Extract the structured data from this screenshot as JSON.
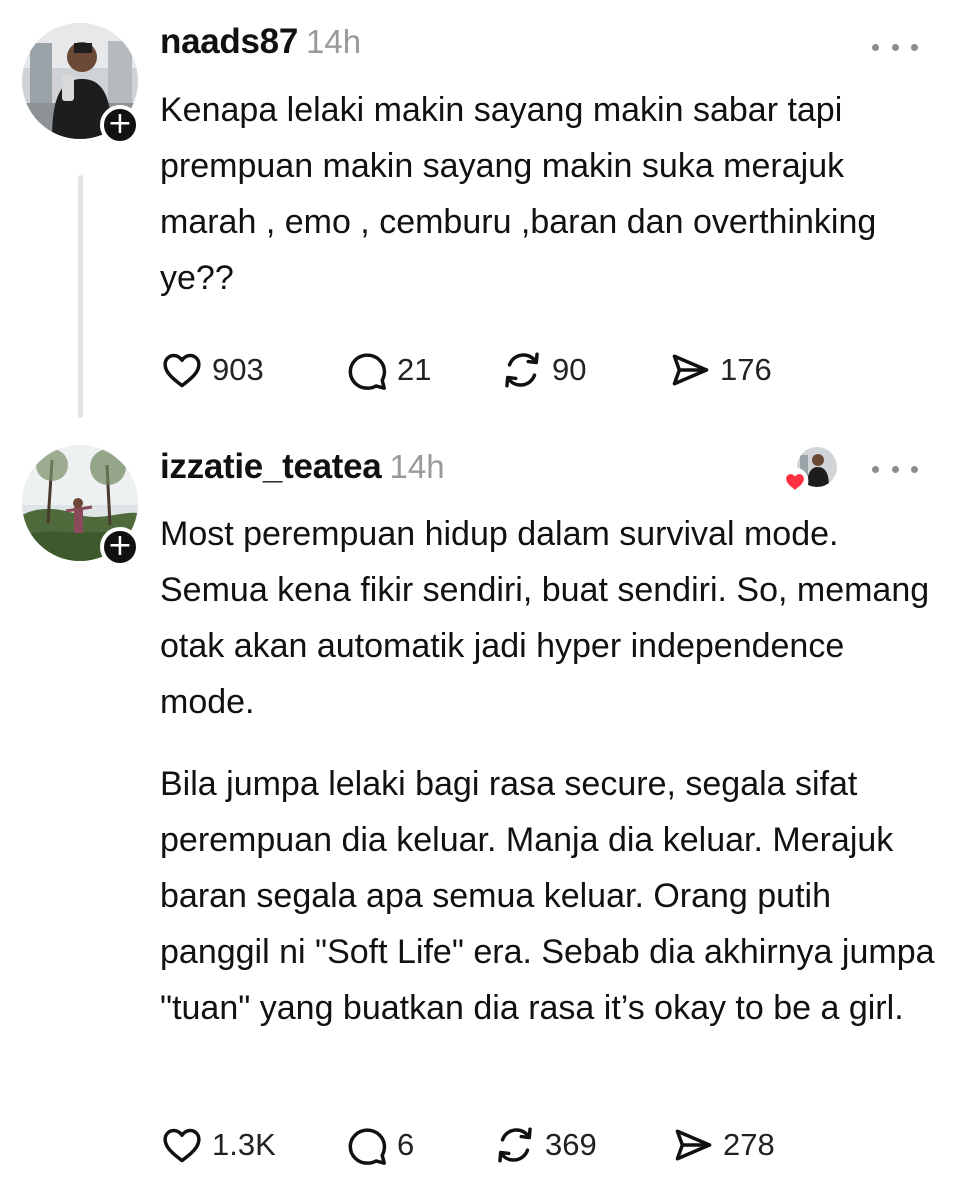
{
  "posts": [
    {
      "username": "naads87",
      "time": "14h",
      "paragraphs": [
        "Kenapa lelaki makin sayang makin sabar tapi prempuan makin sayang makin suka merajuk marah , emo , cemburu ,baran dan overthinking ye??"
      ],
      "likes": "903",
      "replies": "21",
      "reposts": "90",
      "shares": "176"
    },
    {
      "username": "izzatie_teatea",
      "time": "14h",
      "paragraphs": [
        "Most perempuan hidup dalam survival mode. Semua kena fikir sendiri, buat sendiri. So, memang otak akan automatik jadi hyper independence mode.",
        "Bila jumpa lelaki bagi rasa secure, segala sifat perempuan dia keluar. Manja dia keluar. Merajuk baran segala apa semua keluar. Orang putih panggil ni \"Soft Life\" era. Sebab dia akhirnya jumpa \"tuan\" yang buatkan dia rasa it’s okay to be a girl."
      ],
      "likes": "1.3K",
      "replies": "6",
      "reposts": "369",
      "shares": "278"
    }
  ],
  "icons": {
    "like": "heart-outline-icon",
    "reply": "speech-bubble-icon",
    "repost": "repost-arrows-icon",
    "share": "paper-plane-icon",
    "more": "three-dots-icon",
    "follow": "plus-icon",
    "author_liked": "heart-filled-icon"
  },
  "colors": {
    "text": "#111111",
    "muted": "#9a9a9a",
    "heart_badge": "#ff3040",
    "thread_line": "#e3e3e3"
  }
}
